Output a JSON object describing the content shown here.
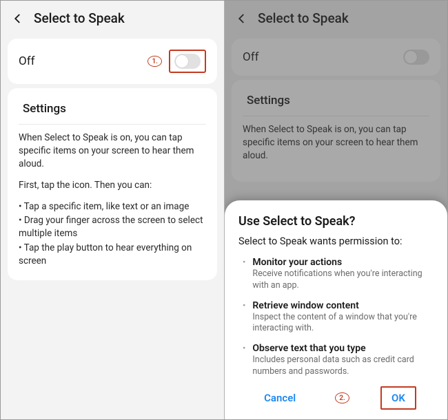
{
  "left": {
    "header_title": "Select to Speak",
    "toggle_label": "Off",
    "marker": "1.",
    "settings_label": "Settings",
    "para1": "When Select to Speak is on, you can tap specific items on your screen to hear them aloud.",
    "para2": "First, tap the icon. Then you can:",
    "bullets": [
      "Tap a specific item, like text or an image",
      "Drag your finger across the screen to select multiple items",
      "Tap the play button to hear everything on screen"
    ]
  },
  "right": {
    "header_title": "Select to Speak",
    "toggle_label": "Off",
    "settings_label": "Settings",
    "para1": "When Select to Speak is on, you can tap specific items on your screen to hear them aloud."
  },
  "dialog": {
    "title": "Use Select to Speak?",
    "subtitle": "Select to Speak wants permission to:",
    "perms": [
      {
        "title": "Monitor your actions",
        "desc": "Receive notifications when you're interacting with an app."
      },
      {
        "title": "Retrieve window content",
        "desc": "Inspect the content of a window that you're interacting with."
      },
      {
        "title": "Observe text that you type",
        "desc": "Includes personal data such as credit card numbers and passwords."
      }
    ],
    "marker": "2.",
    "cancel": "Cancel",
    "ok": "OK"
  }
}
